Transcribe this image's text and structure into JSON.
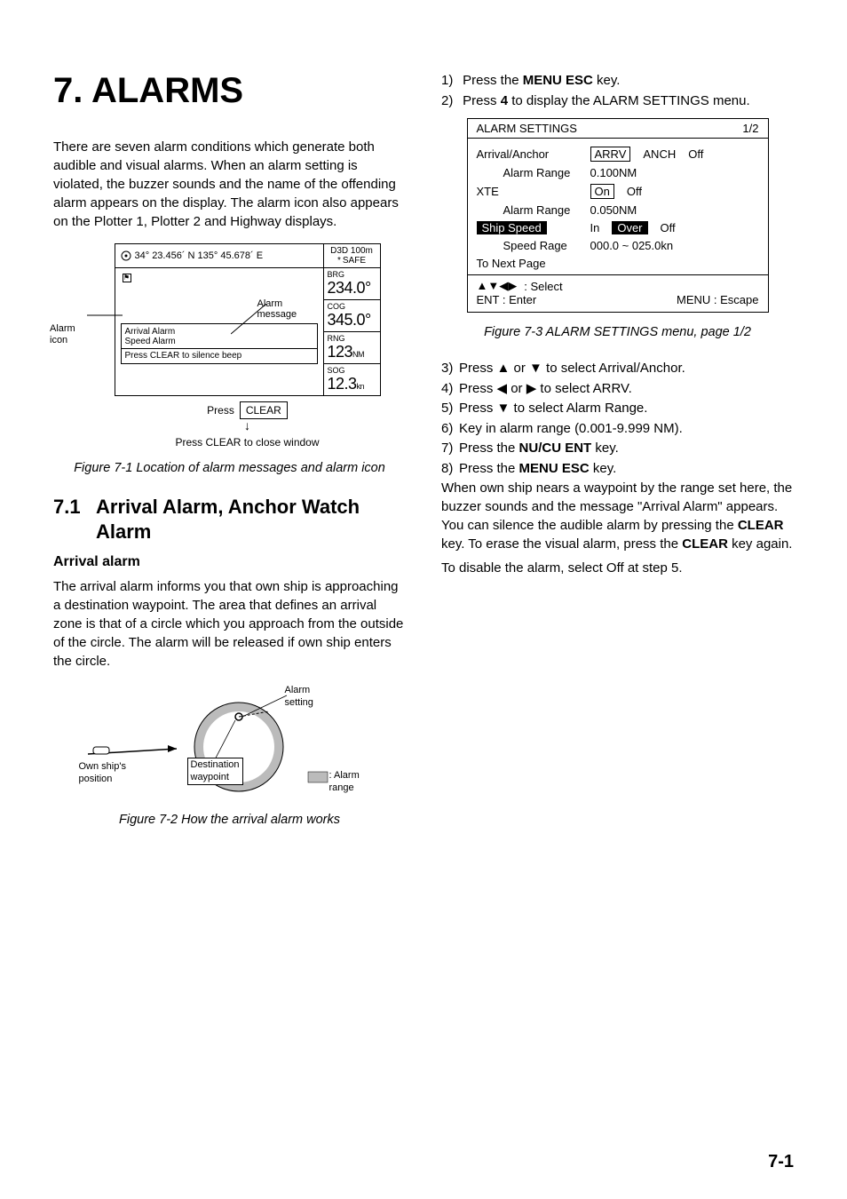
{
  "chapter_title": "7. ALARMS",
  "intro": "There are seven alarm conditions which generate both audible and visual alarms. When an alarm setting is violated, the buzzer sounds and the name of the offending alarm appears on the display. The alarm icon also appears on the Plotter 1, Plotter 2 and Highway displays.",
  "fig1": {
    "position": "34° 23.456´ N  135° 45.678´ E",
    "d3d": "D3D 100m",
    "star_safe": "SAFE",
    "star": "*",
    "brg_lbl": "BRG",
    "brg_val": "234.0",
    "cog_lbl": "COG",
    "cog_val": "345.0",
    "rng_lbl": "RNG",
    "rng_val": "123",
    "rng_unit": "NM",
    "sog_lbl": "SOG",
    "sog_val": "12.3",
    "sog_unit": "kn",
    "alarm_line1": "Arrival Alarm",
    "alarm_line2": "Speed Alarm",
    "alarm_line3": "Press CLEAR to silence beep",
    "label_alarm_msg": "Alarm message",
    "label_alarm_icon1": "Alarm",
    "label_alarm_icon2": "icon",
    "press": "Press",
    "clear_btn": "CLEAR",
    "press_close": "Press CLEAR to close window",
    "caption": "Figure 7-1 Location of alarm messages and alarm icon"
  },
  "sec71": {
    "num": "7.1",
    "title": "Arrival Alarm, Anchor Watch Alarm",
    "sub": "Arrival alarm",
    "body": "The arrival alarm informs you that own ship is approaching a destination waypoint. The area that defines an arrival zone is that of a circle which you approach from the outside of the circle. The alarm will be released if own ship enters the circle."
  },
  "fig2": {
    "alarm_setting": "Alarm setting",
    "own_ship": "Own ship's position",
    "dest_wp": "Destination waypoint",
    "alarm_range": ": Alarm range",
    "caption": "Figure 7-2 How the arrival alarm works"
  },
  "right": {
    "steps_top": [
      {
        "n": "1)",
        "t_a": "Press the ",
        "b": "MENU ESC",
        "t_b": " key."
      },
      {
        "n": "2)",
        "t_a": "Press ",
        "b": "4",
        "t_b": " to display the ALARM SETTINGS menu."
      }
    ],
    "menu": {
      "title": "ALARM SETTINGS",
      "page": "1/2",
      "rows": [
        {
          "lbl": "Arrival/Anchor",
          "opts": [
            "ARRV",
            "ANCH",
            "Off"
          ],
          "style": [
            "boxed",
            "plain",
            "plain"
          ]
        },
        {
          "lbl": "Alarm Range",
          "indent": true,
          "val": "0.100NM"
        },
        {
          "lbl": "XTE",
          "opts": [
            "On",
            "Off"
          ],
          "style": [
            "boxed",
            "plain"
          ]
        },
        {
          "lbl": "Alarm Range",
          "indent": true,
          "val": "0.050NM"
        },
        {
          "lbl": "Ship Speed",
          "lbl_inv": true,
          "opts": [
            "In",
            "Over",
            "Off"
          ],
          "style": [
            "plain",
            "inv",
            "plain"
          ]
        },
        {
          "lbl": "Speed Rage",
          "indent": true,
          "val": "000.0 ~ 025.0kn"
        },
        {
          "lbl": "To Next Page"
        }
      ],
      "footer_select": ": Select",
      "footer_ent": "ENT : Enter",
      "footer_menu": "MENU : Escape"
    },
    "fig3_caption": "Figure 7-3 ALARM SETTINGS menu, page 1/2",
    "steps_345678": [
      {
        "n": "3)",
        "t": "Press ▲ or ▼ to select Arrival/Anchor."
      },
      {
        "n": "4)",
        "t": "Press ◀ or ▶ to select ARRV."
      },
      {
        "n": "5)",
        "t": "Press ▼ to select Alarm Range."
      },
      {
        "n": "6)",
        "t": "Key in alarm range (0.001-9.999 NM)."
      }
    ],
    "step7": {
      "n": "7)",
      "a": "Press the ",
      "b": "NU/CU ENT",
      "c": " key."
    },
    "step8": {
      "n": "8)",
      "a": "Press the ",
      "b": "MENU ESC",
      "c": " key."
    },
    "trailer1": "When own ship nears a waypoint by the range set here, the buzzer sounds and the message \"Arrival Alarm\" appears. You can silence the audible alarm by pressing the ",
    "trailer1_b": "CLEAR",
    "trailer1_c": " key. To erase the visual alarm, press the ",
    "trailer1_d": "CLEAR",
    "trailer1_e": " key again.",
    "trailer2": "To disable the alarm, select Off at step 5."
  },
  "page_number": "7-1"
}
